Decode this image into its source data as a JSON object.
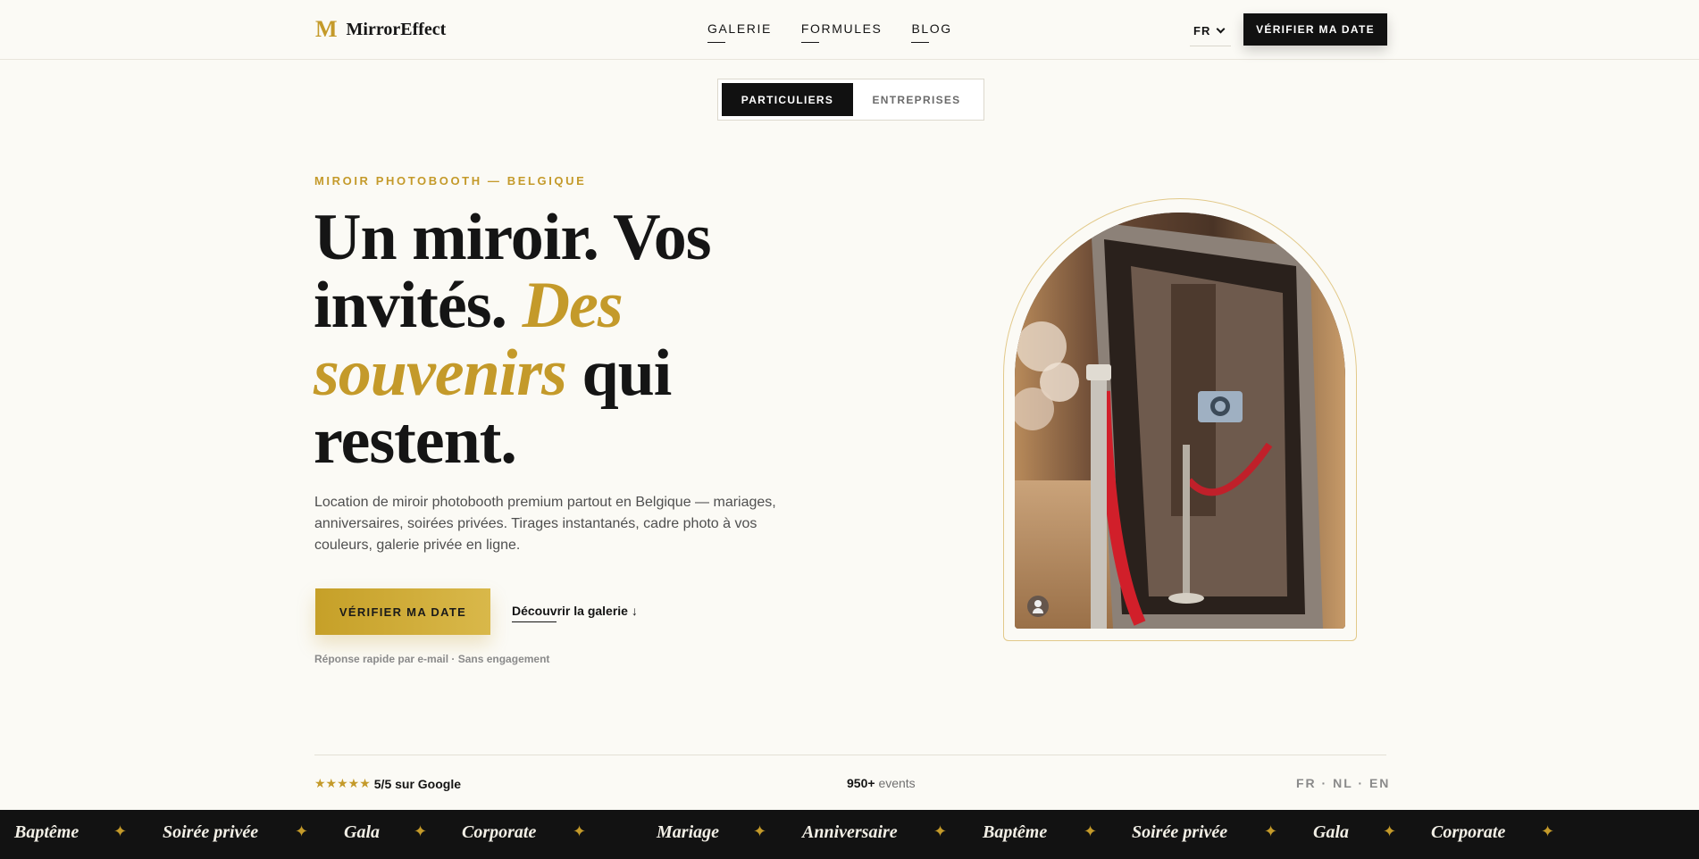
{
  "header": {
    "logo_mark": "M",
    "logo_text": "MirrorEffect",
    "nav": [
      "GALERIE",
      "FORMULES",
      "BLOG"
    ],
    "lang": "FR",
    "cta": "VÉRIFIER MA DATE"
  },
  "toggle": {
    "active": "PARTICULIERS",
    "inactive": "ENTREPRISES"
  },
  "hero": {
    "eyebrow": "MIROIR PHOTOBOOTH — BELGIQUE",
    "headline_1": "Un miroir. Vos invités.",
    "headline_gold": "Des souvenirs",
    "headline_2": "qui restent.",
    "lede": "Location de miroir photobooth premium partout en Belgique — mariages, anniversaires, soirées privées. Tirages instantanés, cadre photo à vos couleurs, galerie privée en ligne.",
    "cta": "VÉRIFIER MA DATE",
    "gallery_link": "Découvrir la galerie ↓",
    "subnote": "Réponse rapide par e-mail · Sans engagement"
  },
  "stats": {
    "stars": "★★★★★",
    "rating": "5/5 sur Google",
    "events_count": "950+",
    "events_label": "events",
    "languages": "FR · NL · EN"
  },
  "marquee": [
    "Baptême",
    "Soirée privée",
    "Gala",
    "Corporate",
    "Mariage",
    "Anniversaire",
    "Baptême",
    "Soirée privée",
    "Gala",
    "Corporate"
  ],
  "colors": {
    "gold": "#c49a2a",
    "dark": "#111111",
    "background": "#fbfaf5"
  }
}
